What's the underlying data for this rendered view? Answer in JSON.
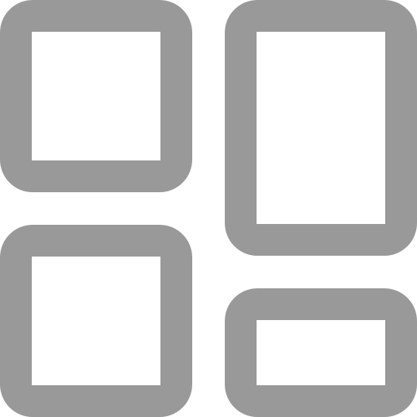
{
  "icon": {
    "name": "dashboard-layout-icon",
    "color": "#999999",
    "background": "#ffffff"
  }
}
